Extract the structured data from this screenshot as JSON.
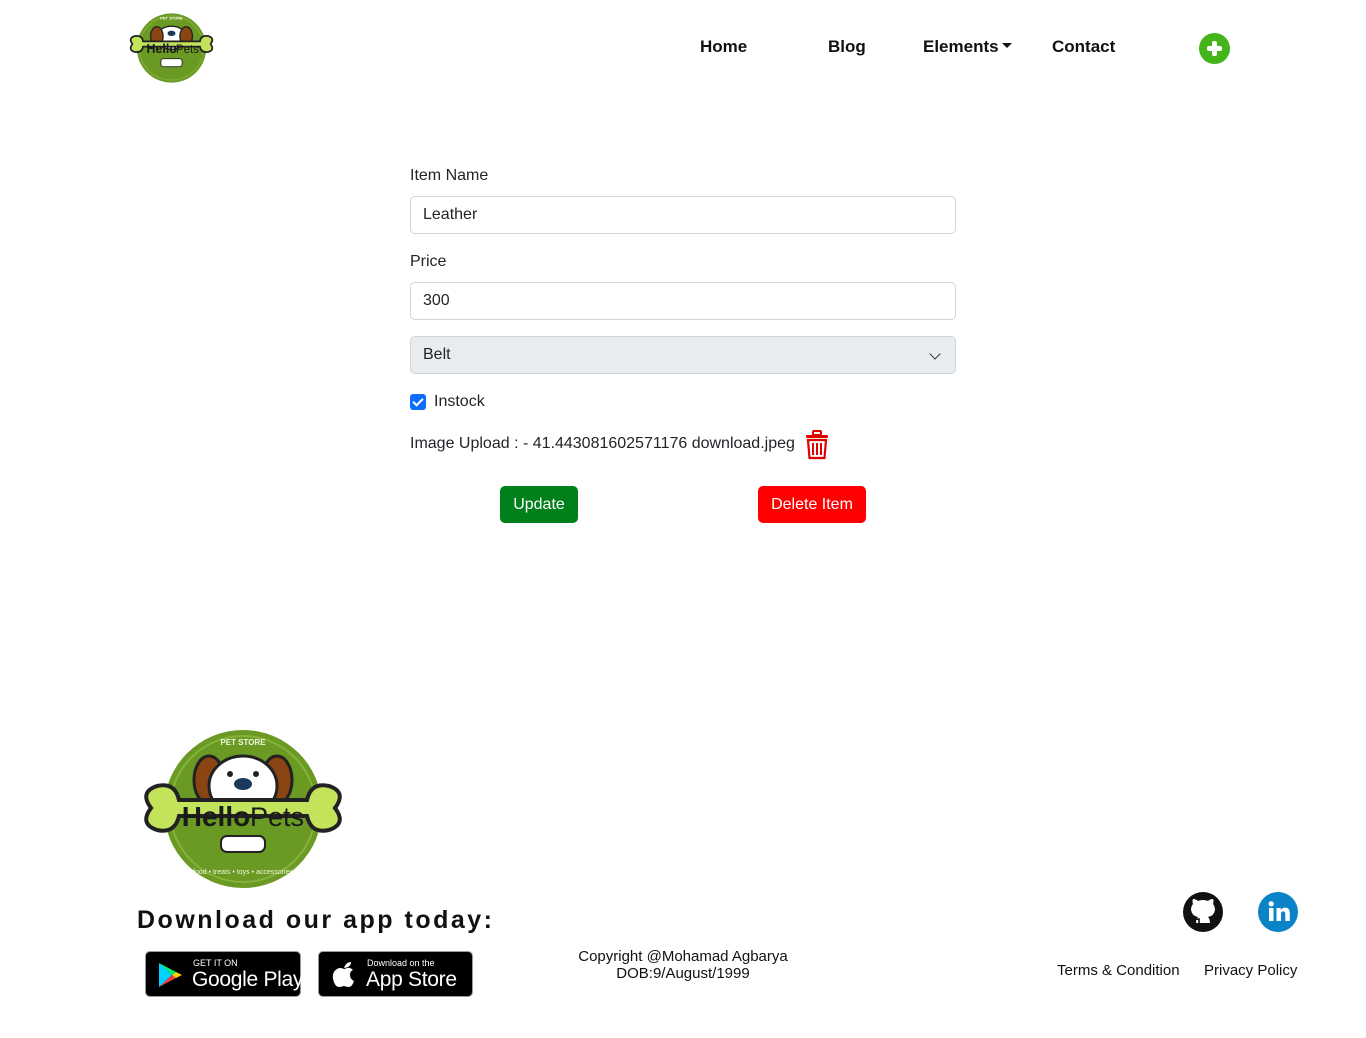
{
  "brand": {
    "logo_text_hello": "Hello",
    "logo_text_pets": "Pets",
    "logo_text_store": "PET STORE",
    "logo_tagline": "food • treats • toys • accessories"
  },
  "nav": {
    "home": "Home",
    "blog": "Blog",
    "elements": "Elements",
    "contact": "Contact",
    "add_icon": "plus-circle-icon"
  },
  "form": {
    "item_name_label": "Item Name",
    "item_name_value": "Leather",
    "price_label": "Price",
    "price_value": "300",
    "category_selected": "Belt",
    "instock_label": "Instock",
    "instock_checked": true,
    "image_upload_text": "Image Upload : - 41.443081602571176 download.jpeg",
    "update_label": "Update",
    "delete_label": "Delete Item"
  },
  "footer": {
    "download_heading": "Download our app today:",
    "google_small": "GET IT ON",
    "google_big": "Google Play",
    "apple_small": "Download on the",
    "apple_big": "App Store",
    "copyright_line1": "Copyright @Mohamad Agbarya",
    "copyright_line2": "DOB:9/August/1999",
    "terms": "Terms & Condition",
    "privacy": "Privacy Policy"
  },
  "colors": {
    "brand_green": "#6a9a23",
    "bone_green": "#c3e35a",
    "update_green": "#00801a",
    "delete_red": "#ff0000",
    "add_green": "#43b51a",
    "checkbox_blue": "#0d6efd",
    "linkedin_blue": "#0a84c6"
  }
}
